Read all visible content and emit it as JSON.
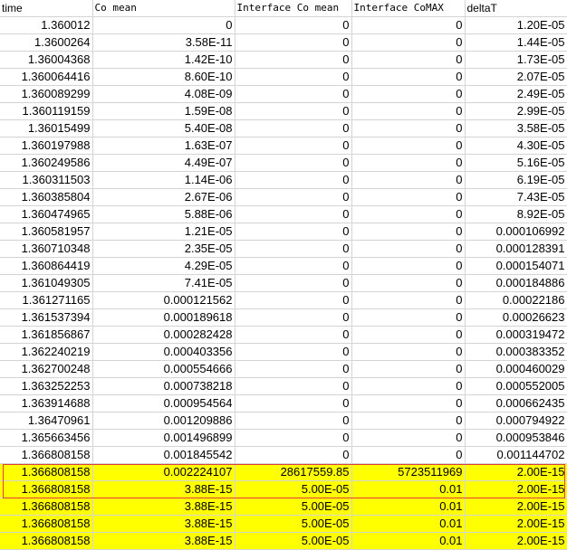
{
  "sheet": {
    "headers": [
      "time",
      "Co mean",
      "Interface Co mean",
      "Interface CoMAX",
      "deltaT"
    ],
    "highlight_color": "#ffff00",
    "selection_color": "#e0403a",
    "rows": [
      [
        "1.360012",
        "0",
        "0",
        "0",
        "1.20E-05"
      ],
      [
        "1.3600264",
        "3.58E-11",
        "0",
        "0",
        "1.44E-05"
      ],
      [
        "1.36004368",
        "1.42E-10",
        "0",
        "0",
        "1.73E-05"
      ],
      [
        "1.360064416",
        "8.60E-10",
        "0",
        "0",
        "2.07E-05"
      ],
      [
        "1.360089299",
        "4.08E-09",
        "0",
        "0",
        "2.49E-05"
      ],
      [
        "1.360119159",
        "1.59E-08",
        "0",
        "0",
        "2.99E-05"
      ],
      [
        "1.36015499",
        "5.40E-08",
        "0",
        "0",
        "3.58E-05"
      ],
      [
        "1.360197988",
        "1.63E-07",
        "0",
        "0",
        "4.30E-05"
      ],
      [
        "1.360249586",
        "4.49E-07",
        "0",
        "0",
        "5.16E-05"
      ],
      [
        "1.360311503",
        "1.14E-06",
        "0",
        "0",
        "6.19E-05"
      ],
      [
        "1.360385804",
        "2.67E-06",
        "0",
        "0",
        "7.43E-05"
      ],
      [
        "1.360474965",
        "5.88E-06",
        "0",
        "0",
        "8.92E-05"
      ],
      [
        "1.360581957",
        "1.21E-05",
        "0",
        "0",
        "0.000106992"
      ],
      [
        "1.360710348",
        "2.35E-05",
        "0",
        "0",
        "0.000128391"
      ],
      [
        "1.360864419",
        "4.29E-05",
        "0",
        "0",
        "0.000154071"
      ],
      [
        "1.361049305",
        "7.41E-05",
        "0",
        "0",
        "0.000184886"
      ],
      [
        "1.361271165",
        "0.000121562",
        "0",
        "0",
        "0.00022186"
      ],
      [
        "1.361537394",
        "0.000189618",
        "0",
        "0",
        "0.00026623"
      ],
      [
        "1.361856867",
        "0.000282428",
        "0",
        "0",
        "0.000319472"
      ],
      [
        "1.362240219",
        "0.000403356",
        "0",
        "0",
        "0.000383352"
      ],
      [
        "1.362700248",
        "0.000554666",
        "0",
        "0",
        "0.000460029"
      ],
      [
        "1.363252253",
        "0.000738218",
        "0",
        "0",
        "0.000552005"
      ],
      [
        "1.363914688",
        "0.000954564",
        "0",
        "0",
        "0.000662435"
      ],
      [
        "1.36470961",
        "0.001209886",
        "0",
        "0",
        "0.000794922"
      ],
      [
        "1.365663456",
        "0.001496899",
        "0",
        "0",
        "0.000953846"
      ],
      [
        "1.366808158",
        "0.001845542",
        "0",
        "0",
        "0.001144702"
      ],
      [
        "1.366808158",
        "0.002224107",
        "28617559.85",
        "5723511969",
        "2.00E-15"
      ],
      [
        "1.366808158",
        "3.88E-15",
        "5.00E-05",
        "0.01",
        "2.00E-15"
      ],
      [
        "1.366808158",
        "3.88E-15",
        "5.00E-05",
        "0.01",
        "2.00E-15"
      ],
      [
        "1.366808158",
        "3.88E-15",
        "5.00E-05",
        "0.01",
        "2.00E-15"
      ],
      [
        "1.366808158",
        "3.88E-15",
        "5.00E-05",
        "0.01",
        "2.00E-15"
      ]
    ]
  }
}
